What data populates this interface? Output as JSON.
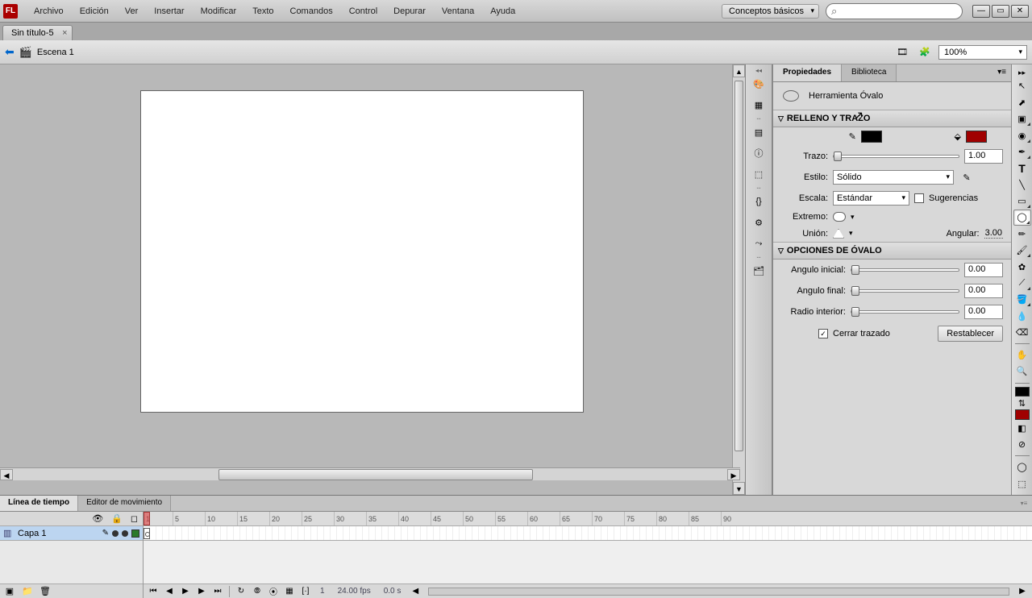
{
  "menu": {
    "items": [
      "Archivo",
      "Edición",
      "Ver",
      "Insertar",
      "Modificar",
      "Texto",
      "Comandos",
      "Control",
      "Depurar",
      "Ventana",
      "Ayuda"
    ]
  },
  "workspace": {
    "label": "Conceptos básicos"
  },
  "doc": {
    "tab": "Sin título-5"
  },
  "scene": {
    "name": "Escena 1",
    "zoom": "100%"
  },
  "panels": {
    "props": "Propiedades",
    "library": "Biblioteca"
  },
  "tool": {
    "name": "Herramienta Óvalo"
  },
  "section1": {
    "title": "RELLENO Y TRAZO",
    "trazo_label": "Trazo:",
    "trazo_val": "1.00",
    "estilo_label": "Estilo:",
    "estilo_val": "Sólido",
    "escala_label": "Escala:",
    "escala_val": "Estándar",
    "sugerencias": "Sugerencias",
    "extremo_label": "Extremo:",
    "union_label": "Unión:",
    "angular_label": "Angular:",
    "angular_val": "3.00"
  },
  "section2": {
    "title": "OPCIONES DE ÓVALO",
    "ang_ini_label": "Angulo inicial:",
    "ang_ini_val": "0.00",
    "ang_fin_label": "Angulo final:",
    "ang_fin_val": "0.00",
    "radio_label": "Radio interior:",
    "radio_val": "0.00",
    "cerrar": "Cerrar trazado",
    "restablecer": "Restablecer"
  },
  "timeline": {
    "tab1": "Línea de tiempo",
    "tab2": "Editor de movimiento",
    "layer": "Capa 1",
    "ruler": [
      "1",
      "5",
      "10",
      "15",
      "20",
      "25",
      "30",
      "35",
      "40",
      "45",
      "50",
      "55",
      "60",
      "65",
      "70",
      "75",
      "80",
      "85",
      "90"
    ],
    "frame": "1",
    "fps": "24.00 fps",
    "time": "0.0 s"
  },
  "colors": {
    "stroke": "#000000",
    "fill": "#a00000"
  }
}
